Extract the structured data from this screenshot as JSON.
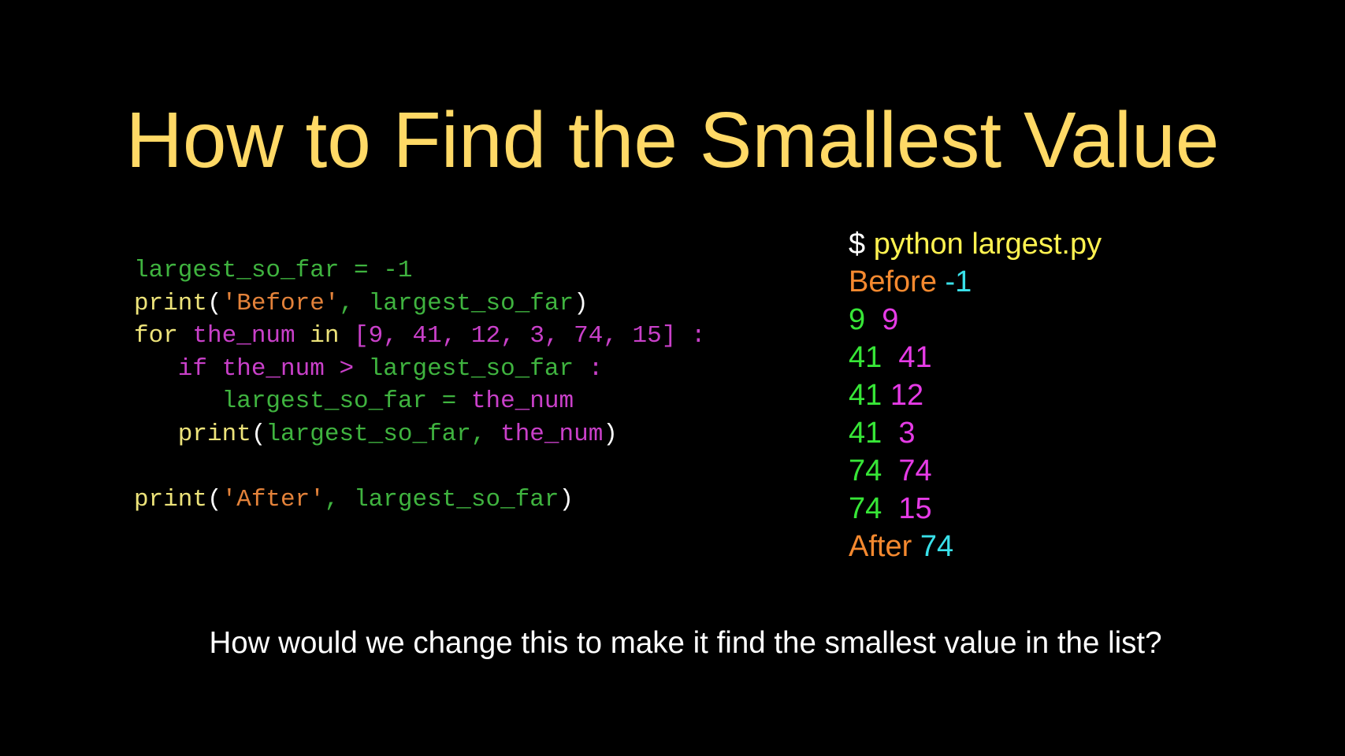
{
  "slide": {
    "title": "How to Find the Smallest Value",
    "question": "How would we change this to make it find the smallest value in the list?"
  },
  "colors": {
    "background": "#000000",
    "title": "#FFD966",
    "code_green": "#3FB33F",
    "code_yellow": "#EDE37A",
    "code_magenta": "#C940C9",
    "code_orange": "#E3823A",
    "code_white": "#FFFFFF",
    "out_white": "#FFFFFF",
    "out_yellow": "#FFF250",
    "out_orange": "#F5892F",
    "out_cyan": "#39E0E9",
    "out_green": "#37E637",
    "out_magenta": "#E63BE6"
  },
  "code": {
    "lines": [
      [
        {
          "text": "largest_so_far = -1",
          "color": "#3FB33F"
        }
      ],
      [
        {
          "text": "print",
          "color": "#EDE37A"
        },
        {
          "text": "(",
          "color": "#FFFFFF"
        },
        {
          "text": "'Before'",
          "color": "#E3823A"
        },
        {
          "text": ", largest_so_far",
          "color": "#3FB33F"
        },
        {
          "text": ")",
          "color": "#FFFFFF"
        }
      ],
      [
        {
          "text": "for ",
          "color": "#EDE37A"
        },
        {
          "text": "the_num",
          "color": "#C940C9"
        },
        {
          "text": " in ",
          "color": "#EDE37A"
        },
        {
          "text": "[9, 41, 12, 3, 74, 15] :",
          "color": "#C940C9"
        }
      ],
      [
        {
          "text": "   if the_num > ",
          "color": "#C940C9"
        },
        {
          "text": "largest_so_far",
          "color": "#3FB33F"
        },
        {
          "text": " :",
          "color": "#C940C9"
        }
      ],
      [
        {
          "text": "      largest_so_far = ",
          "color": "#3FB33F"
        },
        {
          "text": "the_num",
          "color": "#C940C9"
        }
      ],
      [
        {
          "text": "   print",
          "color": "#EDE37A"
        },
        {
          "text": "(",
          "color": "#FFFFFF"
        },
        {
          "text": "largest_so_far, ",
          "color": "#3FB33F"
        },
        {
          "text": "the_num",
          "color": "#C940C9"
        },
        {
          "text": ")",
          "color": "#FFFFFF"
        }
      ],
      [
        {
          "text": "",
          "color": "#FFFFFF"
        }
      ],
      [
        {
          "text": "print",
          "color": "#EDE37A"
        },
        {
          "text": "(",
          "color": "#FFFFFF"
        },
        {
          "text": "'After'",
          "color": "#E3823A"
        },
        {
          "text": ", largest_so_far",
          "color": "#3FB33F"
        },
        {
          "text": ")",
          "color": "#FFFFFF"
        }
      ]
    ]
  },
  "output": {
    "lines": [
      [
        {
          "text": "$ ",
          "color": "#FFFFFF"
        },
        {
          "text": "python largest.py",
          "color": "#FFF250"
        }
      ],
      [
        {
          "text": "Before ",
          "color": "#F5892F"
        },
        {
          "text": "-1",
          "color": "#39E0E9"
        }
      ],
      [
        {
          "text": "9  ",
          "color": "#37E637"
        },
        {
          "text": "9",
          "color": "#E63BE6"
        }
      ],
      [
        {
          "text": "41  ",
          "color": "#37E637"
        },
        {
          "text": "41",
          "color": "#E63BE6"
        }
      ],
      [
        {
          "text": "41 ",
          "color": "#37E637"
        },
        {
          "text": "12",
          "color": "#E63BE6"
        }
      ],
      [
        {
          "text": "41  ",
          "color": "#37E637"
        },
        {
          "text": "3",
          "color": "#E63BE6"
        }
      ],
      [
        {
          "text": "74  ",
          "color": "#37E637"
        },
        {
          "text": "74",
          "color": "#E63BE6"
        }
      ],
      [
        {
          "text": "74  ",
          "color": "#37E637"
        },
        {
          "text": "15",
          "color": "#E63BE6"
        }
      ],
      [
        {
          "text": "After ",
          "color": "#F5892F"
        },
        {
          "text": "74",
          "color": "#39E0E9"
        }
      ]
    ]
  }
}
